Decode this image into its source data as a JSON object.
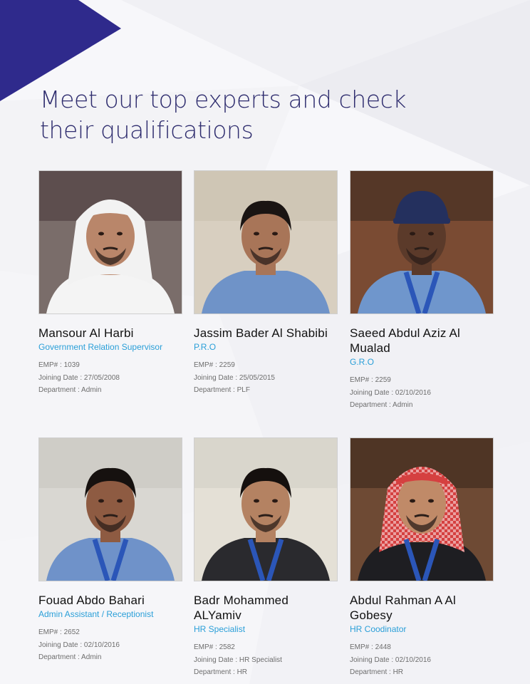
{
  "heading": {
    "line1": "Meet our top experts and check",
    "line2": "their qualifications"
  },
  "colors": {
    "heading": "#2e2c6e",
    "accent_triangle": "#2f2a8c",
    "role_text": "#2a9fd8"
  },
  "experts": [
    {
      "name": "Mansour Al Harbi",
      "role": "Government Relation Supervisor",
      "emp": "EMP# : 1039",
      "joining": "Joining Date : 27/05/2008",
      "department": "Department : Admin",
      "photo_icon": "person-photo-icon"
    },
    {
      "name": "Jassim Bader Al Shabibi",
      "role": "P.R.O",
      "emp": "EMP# : 2259",
      "joining": "Joining Date : 25/05/2015",
      "department": "Department : PLF",
      "photo_icon": "person-photo-icon"
    },
    {
      "name": "Saeed Abdul Aziz Al Mualad",
      "role": "G.R.O",
      "emp": "EMP# : 2259",
      "joining": "Joining Date : 02/10/2016",
      "department": "Department : Admin",
      "photo_icon": "person-photo-icon"
    },
    {
      "name": "Fouad Abdo Bahari",
      "role": "Admin Assistant / Receptionist",
      "emp": "EMP# : 2652",
      "joining": "Joining Date : 02/10/2016",
      "department": "Department : Admin",
      "photo_icon": "person-photo-icon"
    },
    {
      "name": "Badr Mohammed ALYamiv",
      "role": "HR Specialist",
      "emp": "EMP# : 2582",
      "joining": "Joining Date : HR Specialist",
      "department": "Department : HR",
      "photo_icon": "person-photo-icon"
    },
    {
      "name": "Abdul Rahman A Al Gobesy",
      "role": "HR Coodinator",
      "emp": "EMP# : 2448",
      "joining": "Joining Date : 02/10/2016",
      "department": "Department : HR",
      "photo_icon": "person-photo-icon"
    }
  ]
}
